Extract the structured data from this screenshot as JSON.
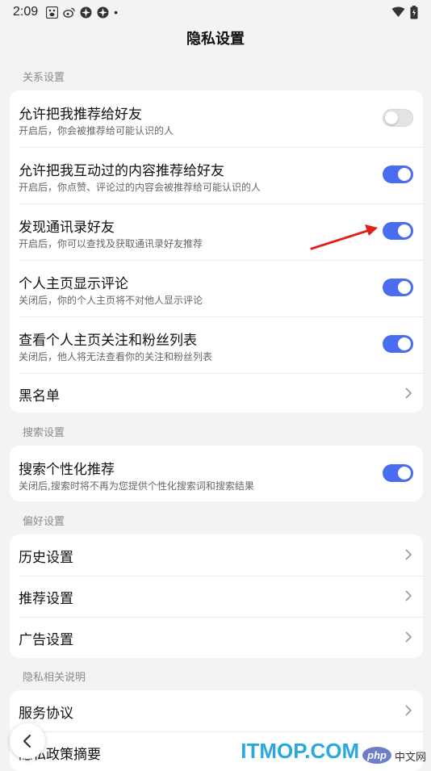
{
  "status_bar": {
    "time": "2:09",
    "dot": "•"
  },
  "header": {
    "title": "隐私设置"
  },
  "sections": {
    "relations": {
      "label": "关系设置",
      "items": [
        {
          "title": "允许把我推荐给好友",
          "subtitle": "开启后，你会被推荐给可能认识的人",
          "toggle": "off"
        },
        {
          "title": "允许把我互动过的内容推荐给好友",
          "subtitle": "开启后，你点赞、评论过的内容会被推荐给可能认识的人",
          "toggle": "on"
        },
        {
          "title": "发现通讯录好友",
          "subtitle": "开启后，你可以查找及获取通讯录好友推荐",
          "toggle": "on"
        },
        {
          "title": "个人主页显示评论",
          "subtitle": "关闭后，你的个人主页将不对他人显示评论",
          "toggle": "on"
        },
        {
          "title": "查看个人主页关注和粉丝列表",
          "subtitle": "关闭后，他人将无法查看你的关注和粉丝列表",
          "toggle": "on"
        }
      ],
      "blacklist": "黑名单"
    },
    "search": {
      "label": "搜索设置",
      "item": {
        "title": "搜索个性化推荐",
        "subtitle": "关闭后,搜索时将不再为您提供个性化搜索词和搜索结果",
        "toggle": "on"
      }
    },
    "preferences": {
      "label": "偏好设置",
      "items": [
        "历史设置",
        "推荐设置",
        "广告设置"
      ]
    },
    "privacy_docs": {
      "label": "隐私相关说明",
      "items": [
        "服务协议",
        "隐私政策摘要"
      ]
    }
  },
  "watermark": {
    "brand": "ITMOP.COM",
    "php": "php",
    "cn": "中文网"
  },
  "colors": {
    "toggle_on": "#4a6cf0",
    "toggle_off": "#e3e3e3",
    "arrow": "#e0201b",
    "background": "#f3f3f3"
  },
  "icons": [
    "baidu-icon",
    "weibo-icon",
    "app-icon",
    "app-icon",
    "wifi-icon",
    "battery-icon",
    "chevron-right-icon",
    "back-arrow-icon"
  ]
}
